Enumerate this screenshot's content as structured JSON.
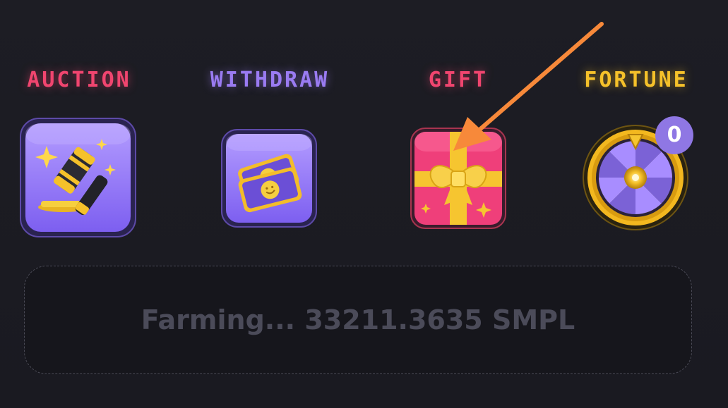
{
  "menu": {
    "items": [
      {
        "label": "AUCTION",
        "color": "#f0456f",
        "icon": "gavel-icon"
      },
      {
        "label": "WITHDRAW",
        "color": "#9a7bf2",
        "icon": "cash-icon"
      },
      {
        "label": "GIFT",
        "color": "#f0456f",
        "icon": "gift-icon"
      },
      {
        "label": "FORTUNE",
        "color": "#f5c12a",
        "icon": "fortune-wheel-icon",
        "badge": "0"
      }
    ]
  },
  "farming": {
    "status": "Farming... 33211.3635 SMPL"
  },
  "annotation": {
    "arrow_color": "#f7893a",
    "points_to": "gift"
  }
}
